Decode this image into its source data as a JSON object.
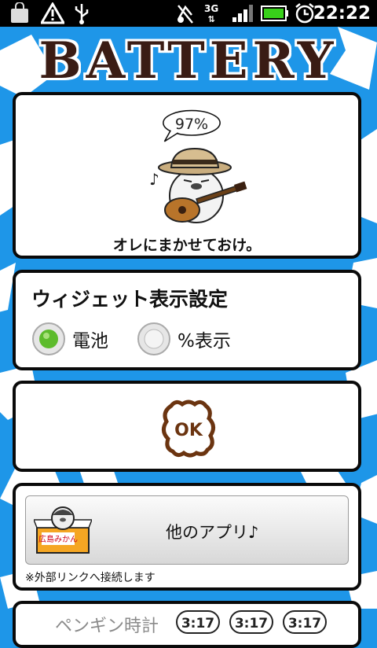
{
  "status_bar": {
    "time": "22:22",
    "network": "3G",
    "icons": [
      "shopping-bag-icon",
      "warning-icon",
      "usb-icon",
      "mute-icon",
      "signal-icon",
      "battery-icon",
      "alarm-icon"
    ]
  },
  "app": {
    "title": "BATTERY"
  },
  "battery_card": {
    "percent": "97%",
    "message": "オレにまかせておけ。",
    "character": "penguin-guitar-illustration"
  },
  "widget_settings": {
    "title": "ウィジェット表示設定",
    "options": [
      {
        "label": "電池",
        "selected": true
      },
      {
        "label": "%表示",
        "selected": false
      }
    ]
  },
  "ok_card": {
    "icon": "ok-stamp-icon"
  },
  "other_apps": {
    "button_label": "他のアプリ♪",
    "box_label": "広島みかん",
    "note": "※外部リンクへ接続します"
  },
  "bottom_card": {
    "partial_text": "ペンギン時計",
    "times": [
      "3:17",
      "3:17",
      "3:17"
    ]
  },
  "colors": {
    "background": "#1e96e8",
    "title": "#3a1c14",
    "radio_selected": "#5dbb2c"
  }
}
